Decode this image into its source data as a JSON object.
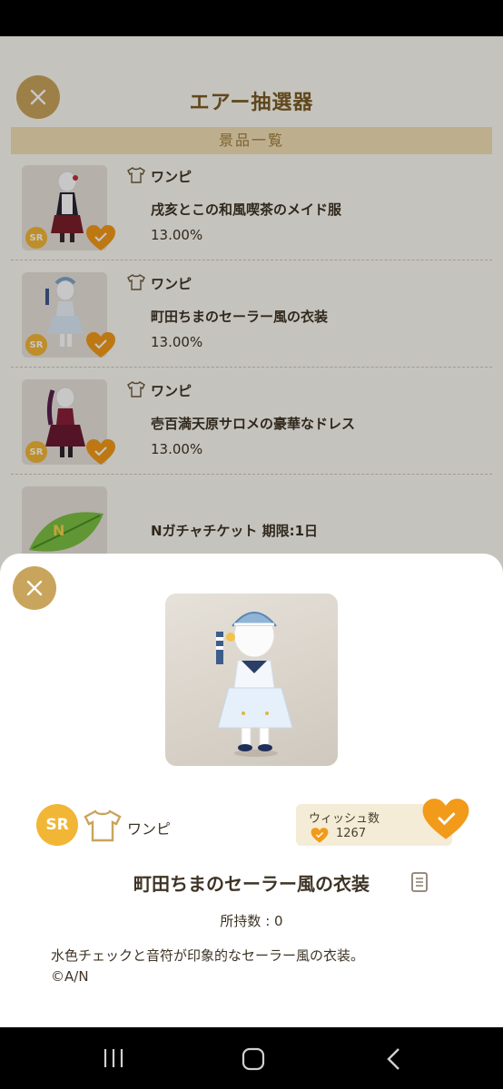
{
  "header": {
    "title": "エアー抽選器"
  },
  "section": {
    "title": "景品一覧"
  },
  "prizes": [
    {
      "category": "ワンピ",
      "name": "戌亥とこの和風喫茶のメイド服",
      "rate": "13.00%",
      "rarity": "SR"
    },
    {
      "category": "ワンピ",
      "name": "町田ちまのセーラー風の衣装",
      "rate": "13.00%",
      "rarity": "SR"
    },
    {
      "category": "ワンピ",
      "name": "壱百満天原サロメの豪華なドレス",
      "rate": "13.00%",
      "rarity": "SR"
    },
    {
      "category": "",
      "name": "Nガチャチケット 期限:1日",
      "rate": "",
      "rarity": ""
    }
  ],
  "detail": {
    "rarity": "SR",
    "category": "ワンピ",
    "wish_label": "ウィッシュ数",
    "wish_count": "1267",
    "name": "町田ちまのセーラー風の衣装",
    "owned": "所持数 : 0",
    "description": "水色チェックと音符が印象的なセーラー風の衣装。",
    "copyright": "©A/N"
  },
  "colors": {
    "gold": "#c9a45c",
    "orange": "#f29a1a",
    "brown": "#7b5d24",
    "badge": "#f2b636"
  },
  "icons": [
    "close-icon",
    "shirt-icon",
    "heart-check-icon",
    "document-icon",
    "recent-apps-icon",
    "home-icon",
    "back-icon"
  ]
}
